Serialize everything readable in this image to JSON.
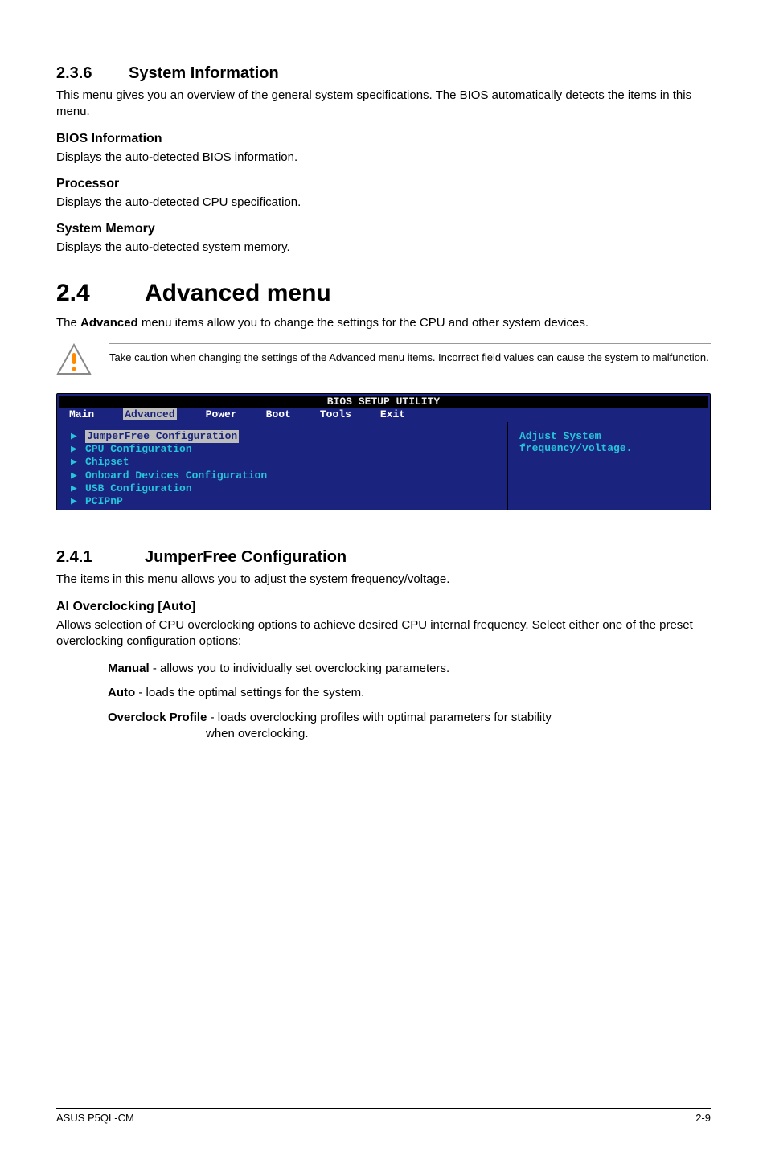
{
  "s236": {
    "heading_num": "2.3.6",
    "heading_text": "System Information",
    "intro": "This menu gives you an overview of the general system specifications. The BIOS automatically detects the items in this menu.",
    "sub_bios_h": "BIOS Information",
    "sub_bios_p": "Displays the auto-detected BIOS information.",
    "sub_proc_h": "Processor",
    "sub_proc_p": "Displays the auto-detected CPU specification.",
    "sub_mem_h": "System Memory",
    "sub_mem_p": "Displays the auto-detected system memory."
  },
  "s24": {
    "heading_num": "2.4",
    "heading_text": "Advanced menu",
    "intro_pre": "The ",
    "intro_bold": "Advanced",
    "intro_post": " menu items allow you to change the settings for the CPU and other system devices.",
    "note": "Take caution when changing the settings of the Advanced menu items. Incorrect field values can cause the system to malfunction."
  },
  "bios": {
    "title": "BIOS SETUP UTILITY",
    "menu": {
      "main": "Main",
      "advanced": "Advanced",
      "power": "Power",
      "boot": "Boot",
      "tools": "Tools",
      "exit": "Exit"
    },
    "items": {
      "jf": "JumperFree Configuration",
      "cpu": "CPU Configuration",
      "chipset": "Chipset",
      "onboard": "Onboard Devices Configuration",
      "usb": "USB Configuration",
      "pcipnp": "PCIPnP"
    },
    "help1": "Adjust System",
    "help2": "frequency/voltage."
  },
  "s241": {
    "heading_num": "2.4.1",
    "heading_text": "JumperFree Configuration",
    "intro": "The items in this menu allows you to adjust the system frequency/voltage.",
    "ai_h": "AI Overclocking [Auto]",
    "ai_p": "Allows selection of CPU overclocking options to achieve desired CPU internal frequency. Select either one of the preset overclocking configuration options:",
    "opt_manual_b": "Manual",
    "opt_manual_t": " - allows you to individually set overclocking parameters.",
    "opt_auto_b": "Auto",
    "opt_auto_t": " - loads the optimal settings for the system.",
    "opt_over_b": "Overclock Profile",
    "opt_over_t1": " - loads overclocking profiles with optimal parameters for stability",
    "opt_over_t2": "when overclocking."
  },
  "footer": {
    "left": "ASUS P5QL-CM",
    "right": "2-9"
  }
}
